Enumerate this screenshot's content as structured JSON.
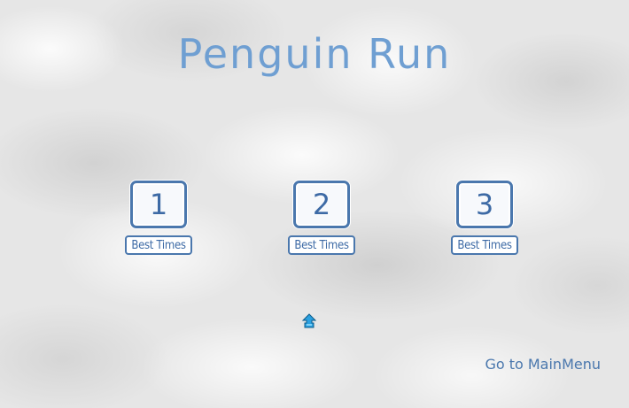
{
  "game": {
    "title": "Penguin Run"
  },
  "levels": [
    {
      "label": "1",
      "best_times_label": "Best Times"
    },
    {
      "label": "2",
      "best_times_label": "Best Times"
    },
    {
      "label": "3",
      "best_times_label": "Best Times"
    }
  ],
  "footer": {
    "main_menu_label": "Go to MainMenu"
  },
  "colors": {
    "title": "#6f9fd2",
    "button_border": "#4a77ad",
    "button_text": "#3d6aa5",
    "cursor": "#2aa0e0"
  },
  "cursor": {
    "icon": "penguin-cursor-icon"
  }
}
